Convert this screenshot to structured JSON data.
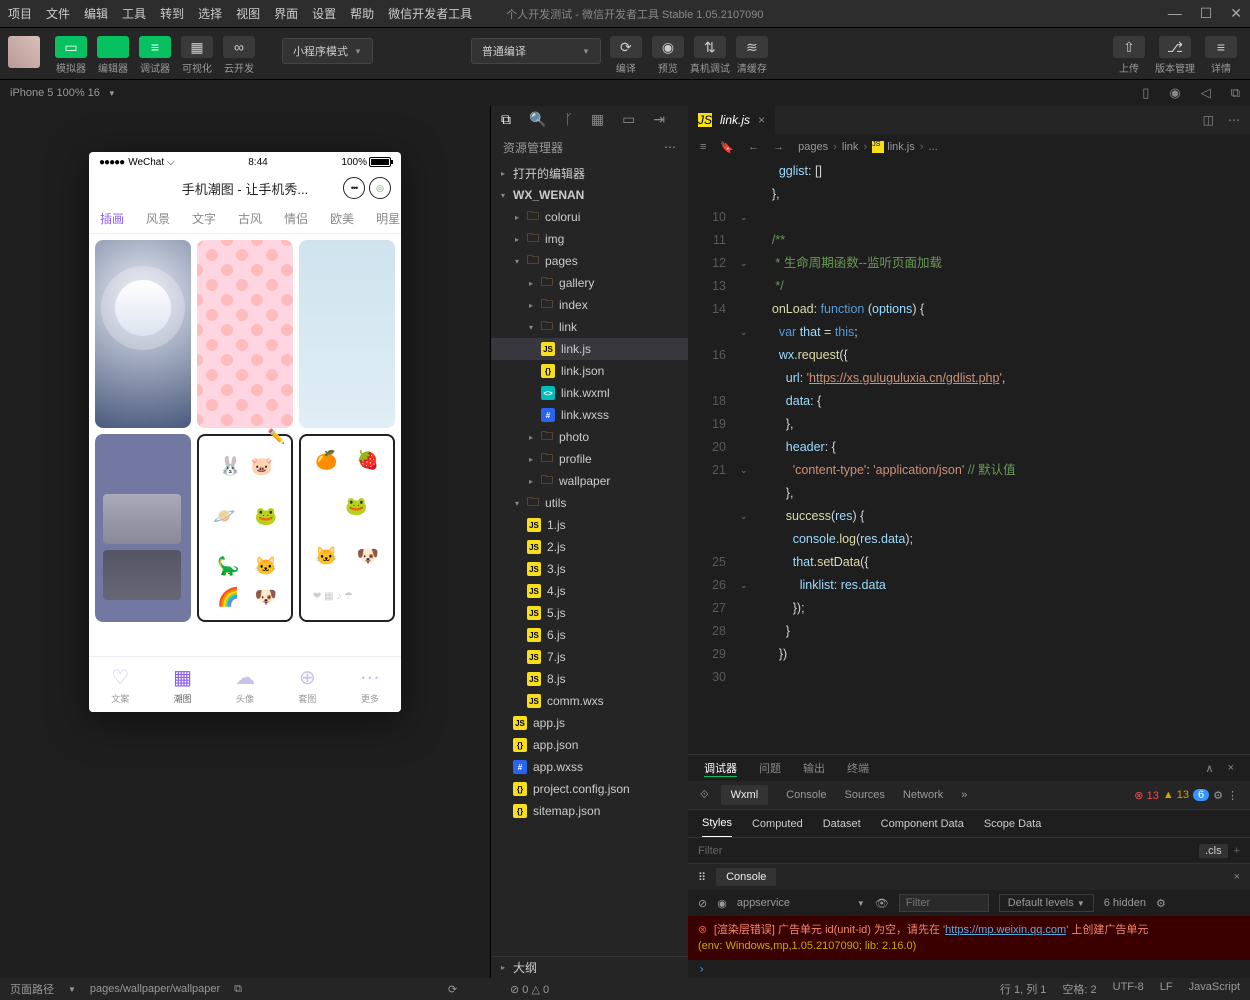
{
  "menubar": {
    "items": [
      "项目",
      "文件",
      "编辑",
      "工具",
      "转到",
      "选择",
      "视图",
      "界面",
      "设置",
      "帮助",
      "微信开发者工具"
    ],
    "title": "个人开发测试 - 微信开发者工具 Stable 1.05.2107090"
  },
  "toolbar": {
    "left": [
      {
        "label": "模拟器",
        "green": true,
        "glyph": "▭"
      },
      {
        "label": "编辑器",
        "green": true,
        "glyph": "</>"
      },
      {
        "label": "调试器",
        "green": true,
        "glyph": "≡"
      },
      {
        "label": "可视化",
        "green": false,
        "glyph": "▦"
      },
      {
        "label": "云开发",
        "green": false,
        "glyph": "∞"
      }
    ],
    "mode": "小程序模式",
    "compile": "普通编译",
    "mid": [
      {
        "label": "编译",
        "glyph": "⟳"
      },
      {
        "label": "预览",
        "glyph": "◉"
      },
      {
        "label": "真机调试",
        "glyph": "⇅"
      },
      {
        "label": "清缓存",
        "glyph": "≋"
      }
    ],
    "right": [
      {
        "label": "上传",
        "glyph": "⇧"
      },
      {
        "label": "版本管理",
        "glyph": "⎇"
      },
      {
        "label": "详情",
        "glyph": "≡"
      }
    ]
  },
  "simhdr": {
    "device": "iPhone 5 100% 16"
  },
  "phone": {
    "carrier": "WeChat",
    "time": "8:44",
    "battery": "100%",
    "title": "手机潮图 - 让手机秀...",
    "tabs": [
      "插画",
      "风景",
      "文字",
      "古风",
      "情侣",
      "欧美",
      "明星"
    ],
    "bottom": [
      {
        "ico": "♡",
        "label": "文案"
      },
      {
        "ico": "▦",
        "label": "潮图"
      },
      {
        "ico": "☁",
        "label": "头像"
      },
      {
        "ico": "⊕",
        "label": "套图"
      },
      {
        "ico": "⋯",
        "label": "更多"
      }
    ]
  },
  "explorer": {
    "title": "资源管理器",
    "sections": {
      "opened": "打开的编辑器",
      "project": "WX_WENAN",
      "outline": "大纲"
    },
    "tree": [
      {
        "n": "colorui",
        "t": "folder",
        "d": 1
      },
      {
        "n": "img",
        "t": "folder",
        "d": 1,
        "ic": "fwxml"
      },
      {
        "n": "pages",
        "t": "folderopen",
        "d": 1
      },
      {
        "n": "gallery",
        "t": "folder",
        "d": 2
      },
      {
        "n": "index",
        "t": "folder",
        "d": 2
      },
      {
        "n": "link",
        "t": "folderopen",
        "d": 2
      },
      {
        "n": "link.js",
        "t": "fjs",
        "d": 3,
        "sel": true
      },
      {
        "n": "link.json",
        "t": "fjson",
        "d": 3
      },
      {
        "n": "link.wxml",
        "t": "fwxml",
        "d": 3
      },
      {
        "n": "link.wxss",
        "t": "fwxss",
        "d": 3
      },
      {
        "n": "photo",
        "t": "folder",
        "d": 2
      },
      {
        "n": "profile",
        "t": "folder",
        "d": 2
      },
      {
        "n": "wallpaper",
        "t": "folder",
        "d": 2
      },
      {
        "n": "utils",
        "t": "folderopen",
        "d": 1
      },
      {
        "n": "1.js",
        "t": "fjs",
        "d": 2
      },
      {
        "n": "2.js",
        "t": "fjs",
        "d": 2
      },
      {
        "n": "3.js",
        "t": "fjs",
        "d": 2
      },
      {
        "n": "4.js",
        "t": "fjs",
        "d": 2
      },
      {
        "n": "5.js",
        "t": "fjs",
        "d": 2
      },
      {
        "n": "6.js",
        "t": "fjs",
        "d": 2
      },
      {
        "n": "7.js",
        "t": "fjs",
        "d": 2
      },
      {
        "n": "8.js",
        "t": "fjs",
        "d": 2
      },
      {
        "n": "comm.wxs",
        "t": "fwxs",
        "d": 2
      },
      {
        "n": "app.js",
        "t": "fjs",
        "d": 1
      },
      {
        "n": "app.json",
        "t": "fjson",
        "d": 1
      },
      {
        "n": "app.wxss",
        "t": "fwxss",
        "d": 1
      },
      {
        "n": "project.config.json",
        "t": "fjson",
        "d": 1
      },
      {
        "n": "sitemap.json",
        "t": "fjson",
        "d": 1
      }
    ]
  },
  "editor": {
    "tab": "link.js",
    "breadcrumb": [
      "pages",
      "link",
      "link.js",
      "..."
    ],
    "code": [
      {
        "l": "",
        "h": "      <span class='p'>gglist</span>: []"
      },
      {
        "l": "",
        "h": "    },"
      },
      {
        "l": "10",
        "h": ""
      },
      {
        "l": "11",
        "h": "    <span class='c'>/**</span>"
      },
      {
        "l": "12",
        "h": "<span class='c'>     * 生命周期函数--监听页面加载</span>"
      },
      {
        "l": "13",
        "h": "<span class='c'>     */</span>"
      },
      {
        "l": "14",
        "h": "    <span class='f'>onLoad</span>: <span class='k'>function</span> (<span class='p'>options</span>) {"
      },
      {
        "l": "",
        "h": "      <span class='k'>var</span> <span class='p'>that</span> = <span class='k'>this</span>;"
      },
      {
        "l": "16",
        "h": "      <span class='p'>wx</span>.<span class='f'>request</span>({"
      },
      {
        "l": "",
        "h": "        <span class='p'>url</span>: <span class='s'>'</span><span class='url'>https://xs.guluguluxia.cn/gdlist.php</span><span class='s'>'</span>,"
      },
      {
        "l": "18",
        "h": "        <span class='p'>data</span>: {"
      },
      {
        "l": "19",
        "h": "        },"
      },
      {
        "l": "20",
        "h": "        <span class='p'>header</span>: {"
      },
      {
        "l": "21",
        "h": "          <span class='s'>'content-type'</span>: <span class='s'>'application/json'</span> <span class='c'>// 默认值</span>"
      },
      {
        "l": "",
        "h": "        },"
      },
      {
        "l": "",
        "h": "        <span class='f'>success</span>(<span class='p'>res</span>) {"
      },
      {
        "l": "",
        "h": "          <span class='p'>console</span>.<span class='f'>log</span>(<span class='p'>res</span>.<span class='p'>data</span>);"
      },
      {
        "l": "25",
        "h": "          <span class='p'>that</span>.<span class='f'>setData</span>({"
      },
      {
        "l": "26",
        "h": "            <span class='p'>linklist</span>: <span class='p'>res</span>.<span class='p'>data</span>"
      },
      {
        "l": "27",
        "h": "          });"
      },
      {
        "l": "28",
        "h": "        }"
      },
      {
        "l": "29",
        "h": "      })"
      },
      {
        "l": "30",
        "h": ""
      }
    ]
  },
  "panel": {
    "tabs": [
      "调试器",
      "问题",
      "输出",
      "终端"
    ],
    "devtabs": [
      "Wxml",
      "Console",
      "Sources",
      "Network"
    ],
    "badges": {
      "err": "13",
      "warn": "13",
      "info": "6"
    },
    "styletabs": [
      "Styles",
      "Computed",
      "Dataset",
      "Component Data",
      "Scope Data"
    ],
    "filter": "Filter",
    "cls": ".cls"
  },
  "console": {
    "title": "Console",
    "context": "appservice",
    "filter": "Filter",
    "levels": "Default levels",
    "hidden": "6 hidden",
    "err1": "[渲染层错误] 广告单元 id(unit-id) 为空，请先在 '",
    "errurl": "https://mp.weixin.qq.com",
    "err2": "' 上创建广告单元",
    "env": "(env: Windows,mp,1.05.2107090; lib: 2.16.0)"
  },
  "status": {
    "path_label": "页面路径",
    "path": "pages/wallpaper/wallpaper",
    "diag": "⊘ 0 △ 0",
    "right": [
      "行 1, 列 1",
      "空格: 2",
      "UTF-8",
      "LF",
      "JavaScript"
    ]
  }
}
